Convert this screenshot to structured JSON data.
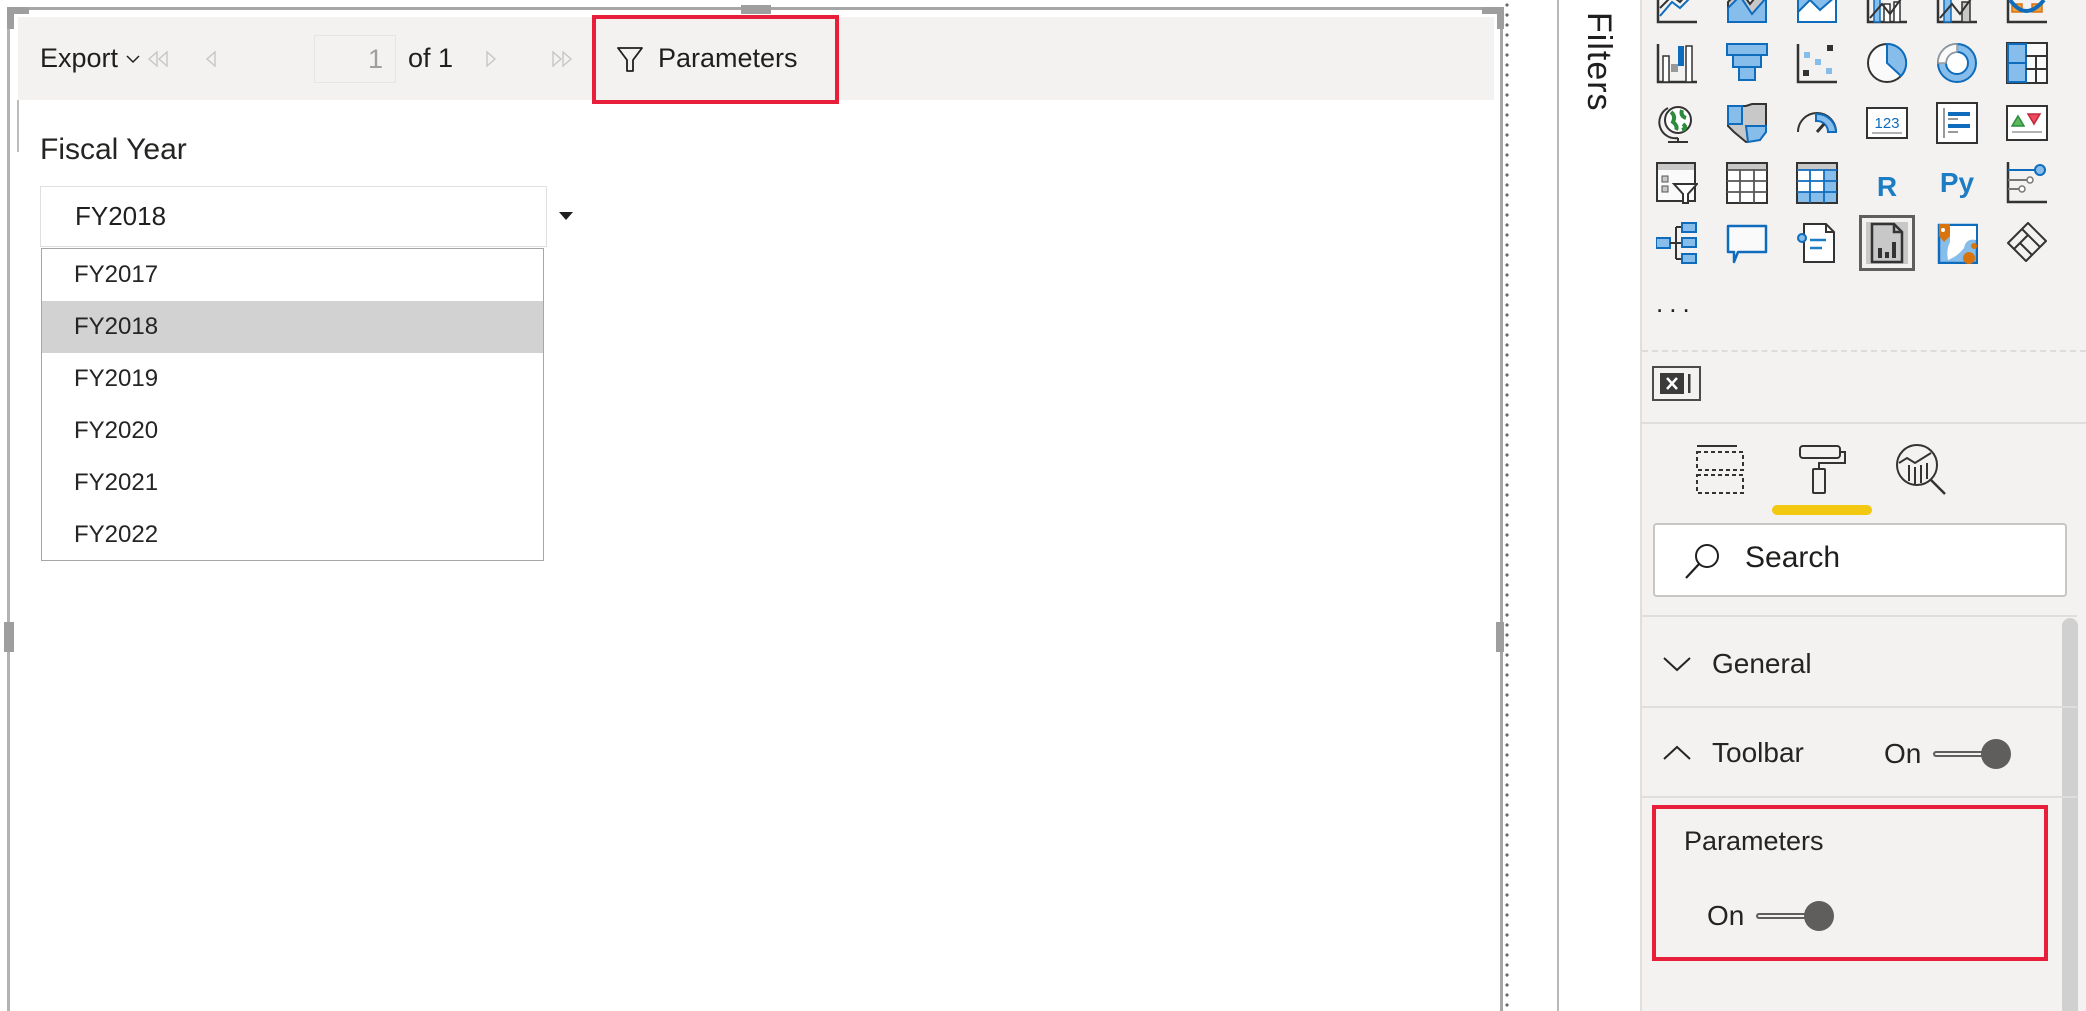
{
  "toolbar": {
    "export_label": "Export",
    "page_current": "1",
    "page_of": "of 1",
    "parameters_label": "Parameters"
  },
  "parameter": {
    "label": "Fiscal Year",
    "selected": "FY2018",
    "options": [
      {
        "label": "FY2017",
        "selected": false
      },
      {
        "label": "FY2018",
        "selected": true
      },
      {
        "label": "FY2019",
        "selected": false
      },
      {
        "label": "FY2020",
        "selected": false
      },
      {
        "label": "FY2021",
        "selected": false
      },
      {
        "label": "FY2022",
        "selected": false
      }
    ]
  },
  "filters_pane": {
    "label": "Filters"
  },
  "visualizations": {
    "icons": [
      [
        "line-chart",
        "area-chart",
        "stacked-area-chart",
        "line-clustered-column-chart",
        "line-stacked-column-chart",
        "ribbon-chart"
      ],
      [
        "waterfall-chart",
        "funnel-chart",
        "scatter-chart",
        "pie-chart",
        "donut-chart",
        "treemap"
      ],
      [
        "map",
        "filled-map",
        "gauge",
        "card",
        "multi-row-card",
        "kpi"
      ],
      [
        "slicer",
        "table",
        "matrix",
        "r-script-visual",
        "python-visual",
        "key-influencers"
      ],
      [
        "decomposition-tree",
        "qa-visual",
        "smart-narrative",
        "paginated-report-visual",
        "azure-map",
        "power-apps"
      ]
    ],
    "active_icon": "paginated-report-visual",
    "r_label": "R",
    "py_label": "Py",
    "card_label": "123",
    "more_label": "..."
  },
  "pane_tabs": {
    "items": [
      "fields",
      "format",
      "analytics"
    ],
    "active": "format"
  },
  "format_pane": {
    "search_placeholder": "Search",
    "sections": [
      {
        "label": "General",
        "expanded": false
      },
      {
        "label": "Toolbar",
        "expanded": true,
        "toggle_label": "On",
        "toggle_on": true
      }
    ],
    "parameters_card": {
      "label": "Parameters",
      "toggle_label": "On",
      "toggle_on": true
    }
  },
  "colors": {
    "highlight_red": "#e81f3a",
    "active_tab_yellow": "#f2c811",
    "icon_blue": "#0f6cbd",
    "icon_light_blue": "#86bdea",
    "toolbar_bg": "#f3f2f1"
  }
}
